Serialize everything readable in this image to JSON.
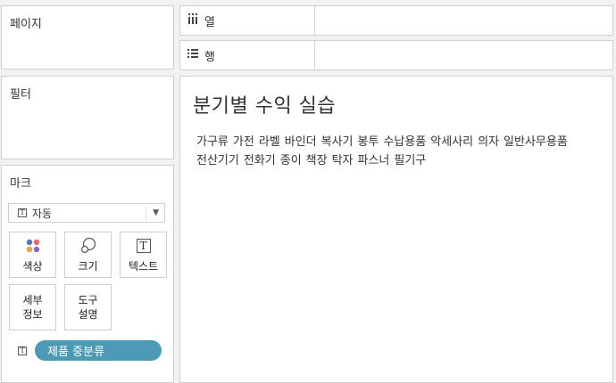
{
  "pages_card": {
    "title": "페이지"
  },
  "filters_card": {
    "title": "필터"
  },
  "columns_shelf": {
    "label": "열",
    "icon": "columns-icon"
  },
  "rows_shelf": {
    "label": "행",
    "icon": "rows-icon"
  },
  "marks": {
    "title": "마크",
    "mark_type": "자동",
    "buttons": {
      "color": "색상",
      "size": "크기",
      "text": "텍스트",
      "detail_line1": "세부",
      "detail_line2": "정보",
      "tooltip_line1": "도구",
      "tooltip_line2": "설명"
    },
    "pill": "제품 중분류"
  },
  "view": {
    "title": "분기별 수익 실습",
    "words": [
      "가구류",
      "가전",
      "라벨",
      "바인더",
      "복사기",
      "봉투",
      "수납용품",
      "악세사리",
      "의자",
      "일반사무용품",
      "전산기기",
      "전화기",
      "종이",
      "책장",
      "탁자",
      "파스너",
      "필기구"
    ]
  },
  "colors": {
    "background": "#f2f2f2",
    "pill": "#4c9ab5"
  }
}
